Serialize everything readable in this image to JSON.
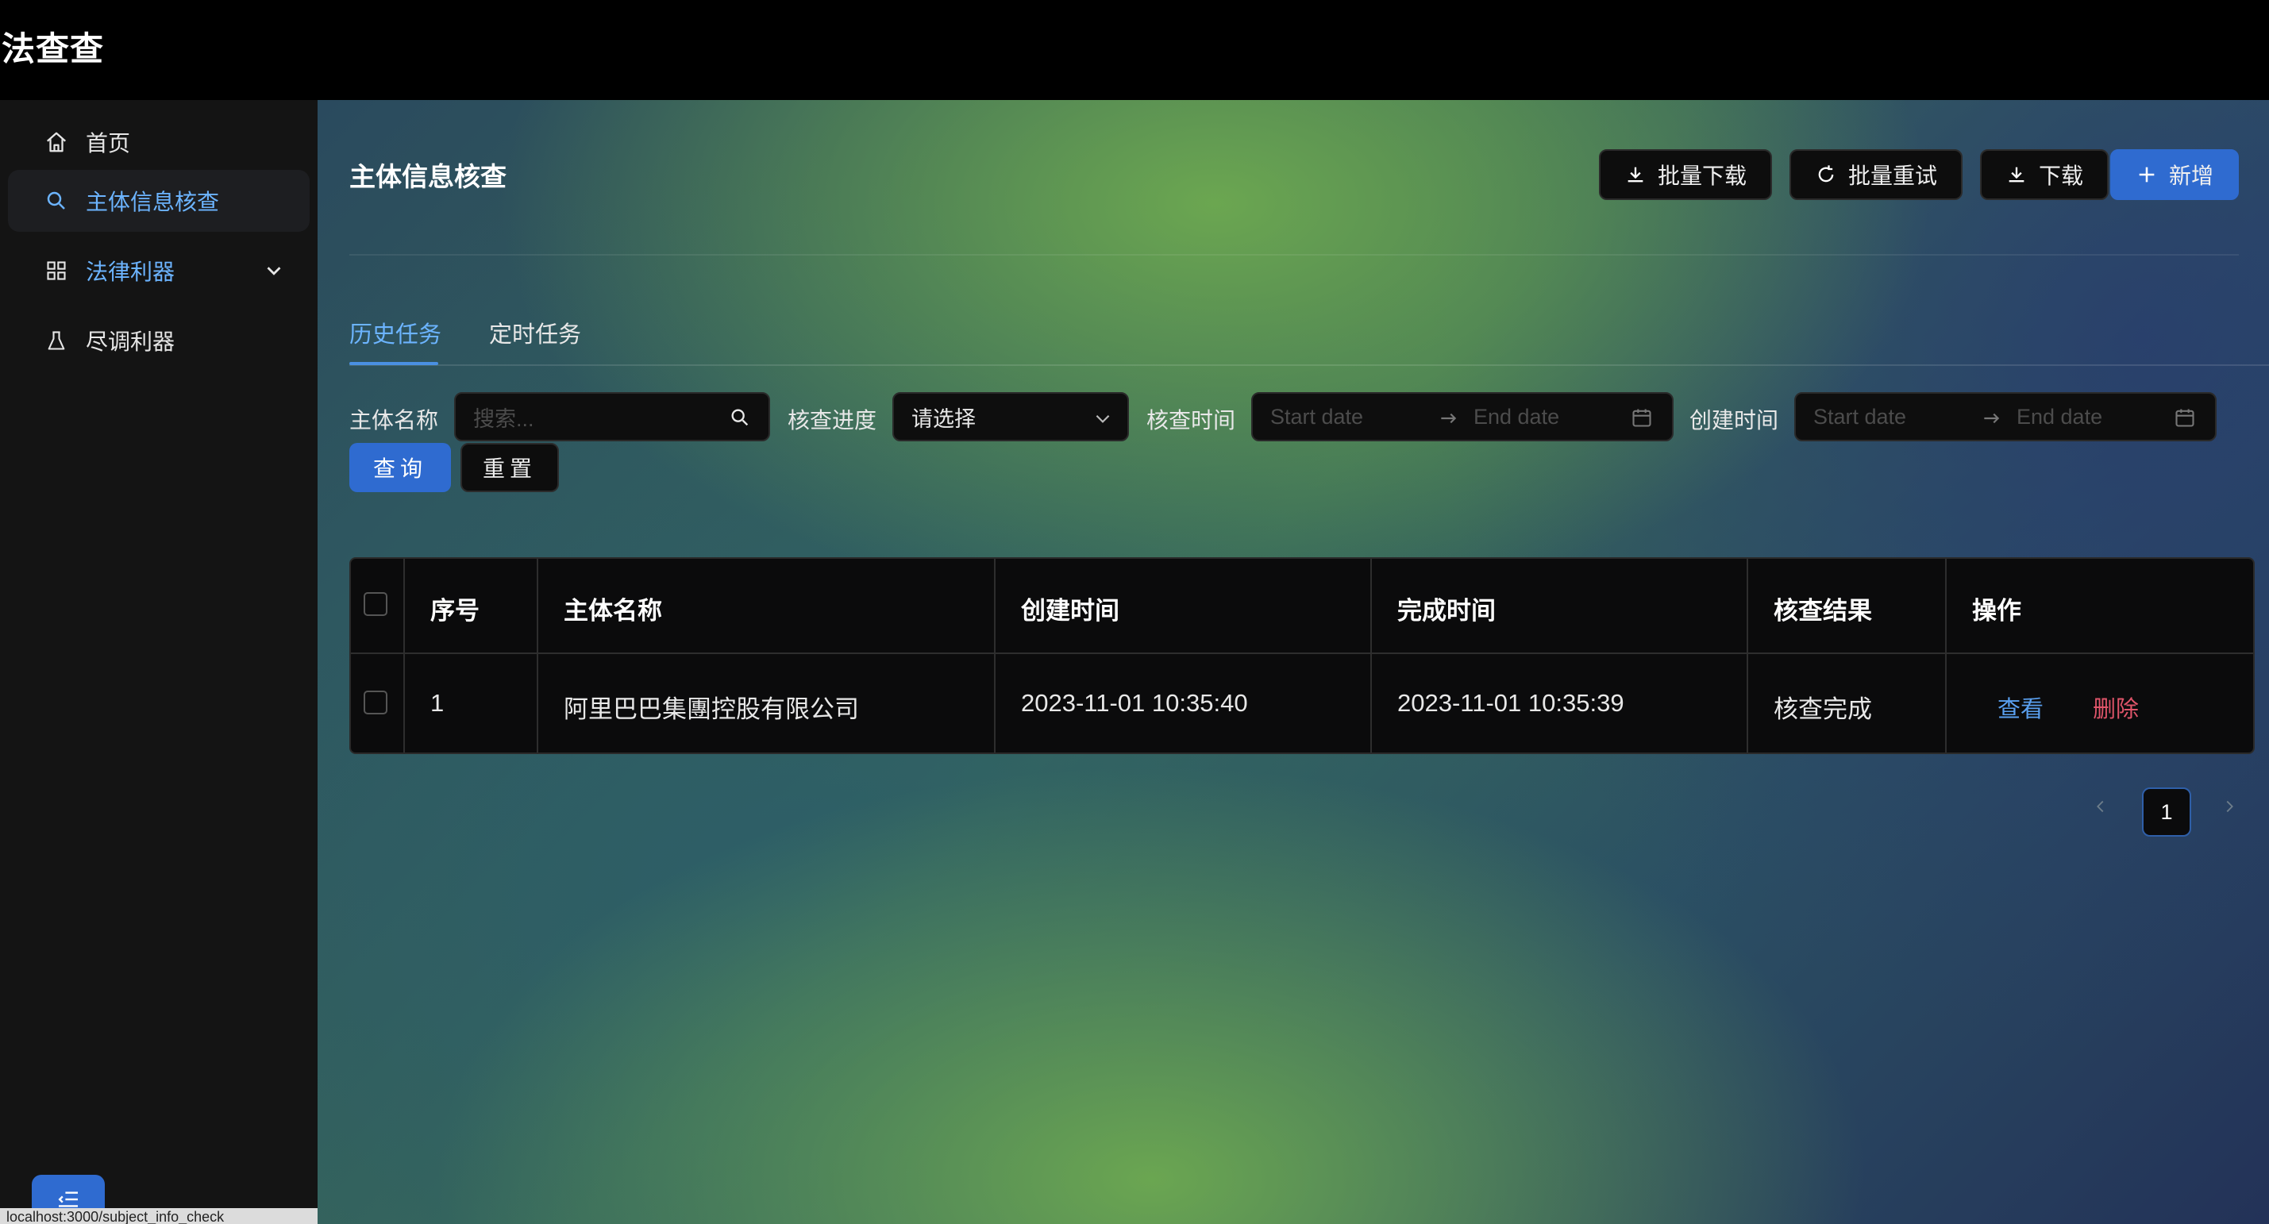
{
  "app": {
    "title": "法查查"
  },
  "sidebar": {
    "items": [
      {
        "label": "首页",
        "icon": "home-icon"
      },
      {
        "label": "主体信息核查",
        "icon": "search-icon"
      },
      {
        "label": "法律利器",
        "icon": "grid-icon"
      },
      {
        "label": "尽调利器",
        "icon": "flask-icon"
      }
    ],
    "status_url": "localhost:3000/subject_info_check"
  },
  "header": {
    "title": "主体信息核查",
    "buttons": {
      "batch_download": "批量下载",
      "batch_retry": "批量重试",
      "download": "下载",
      "add": "新增"
    }
  },
  "tabs": [
    {
      "label": "历史任务"
    },
    {
      "label": "定时任务"
    }
  ],
  "filters": {
    "subject_name_label": "主体名称",
    "search_placeholder": "搜索...",
    "progress_label": "核查进度",
    "progress_value": "请选择",
    "check_time_label": "核查时间",
    "create_time_label": "创建时间",
    "start_placeholder": "Start date",
    "end_placeholder": "End date",
    "query_button": "查询",
    "reset_button": "重置"
  },
  "table": {
    "columns": [
      "序号",
      "主体名称",
      "创建时间",
      "完成时间",
      "核查结果",
      "操作"
    ],
    "rows": [
      {
        "index": "1",
        "name": "阿里巴巴集團控股有限公司",
        "created": "2023-11-01 10:35:40",
        "completed": "2023-11-01 10:35:39",
        "result": "核查完成",
        "actions": {
          "view": "查看",
          "delete": "删除"
        }
      }
    ]
  },
  "pagination": {
    "current": "1"
  },
  "colors": {
    "accent": "#2f6bd0",
    "link": "#5aa0f0",
    "danger": "#e0556a"
  }
}
